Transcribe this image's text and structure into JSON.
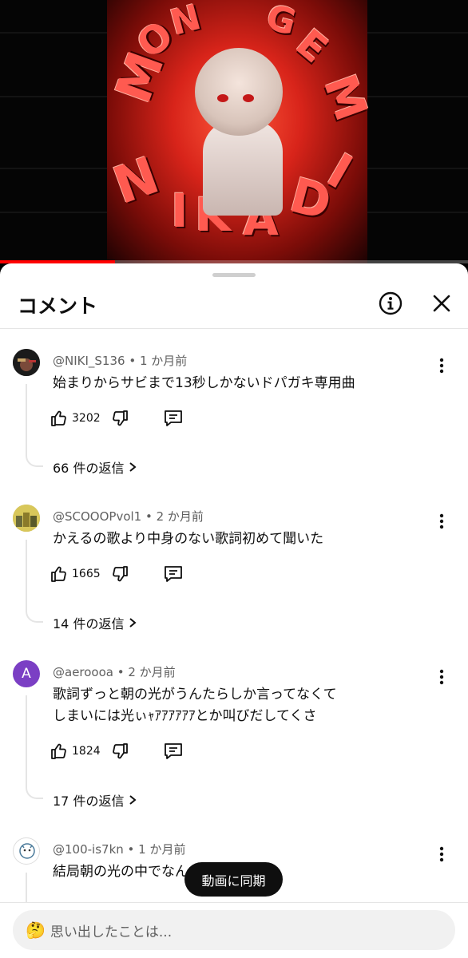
{
  "video": {
    "progress": 0.245,
    "art_text_top": "MONTAGEM",
    "art_text_bottom": "NIKADI"
  },
  "sheet": {
    "title": "コメント",
    "info_icon": "info-icon",
    "close_icon": "close-icon"
  },
  "comments": [
    {
      "author": "@NIKI_S136",
      "age": "1 か月前",
      "text": "始まりからサビまで13秒しかないドパガキ専用曲",
      "likes": "3202",
      "replies": "66 件の返信",
      "avatar_color": "#2a2a2a"
    },
    {
      "author": "@SCOOOPvol1",
      "age": "2 か月前",
      "text": "かえるの歌より中身のない歌詞初めて聞いた",
      "likes": "1665",
      "replies": "14 件の返信",
      "avatar_color": "#b8a23a"
    },
    {
      "author": "@aeroooa",
      "age": "2 か月前",
      "text_line1": "歌詞ずっと朝の光がうんたらしか言ってなくて",
      "text_line2": "しまいには光ぃｬｱｱｱｱｱｱとか叫びだしてくさ",
      "likes": "1824",
      "replies": "17 件の返信",
      "avatar_letter": "A",
      "avatar_color": "#7b3fc4"
    },
    {
      "author": "@100-is7kn",
      "age": "1 か月前",
      "text": "結局朝の光の中でなん",
      "avatar_color": "#ffffff"
    }
  ],
  "toast": "動画に同期",
  "input": {
    "emoji": "🤔",
    "placeholder": "思い出したことは..."
  },
  "colors": {
    "accent": "#ff0000",
    "text_primary": "#0f0f0f",
    "text_secondary": "#606060"
  }
}
